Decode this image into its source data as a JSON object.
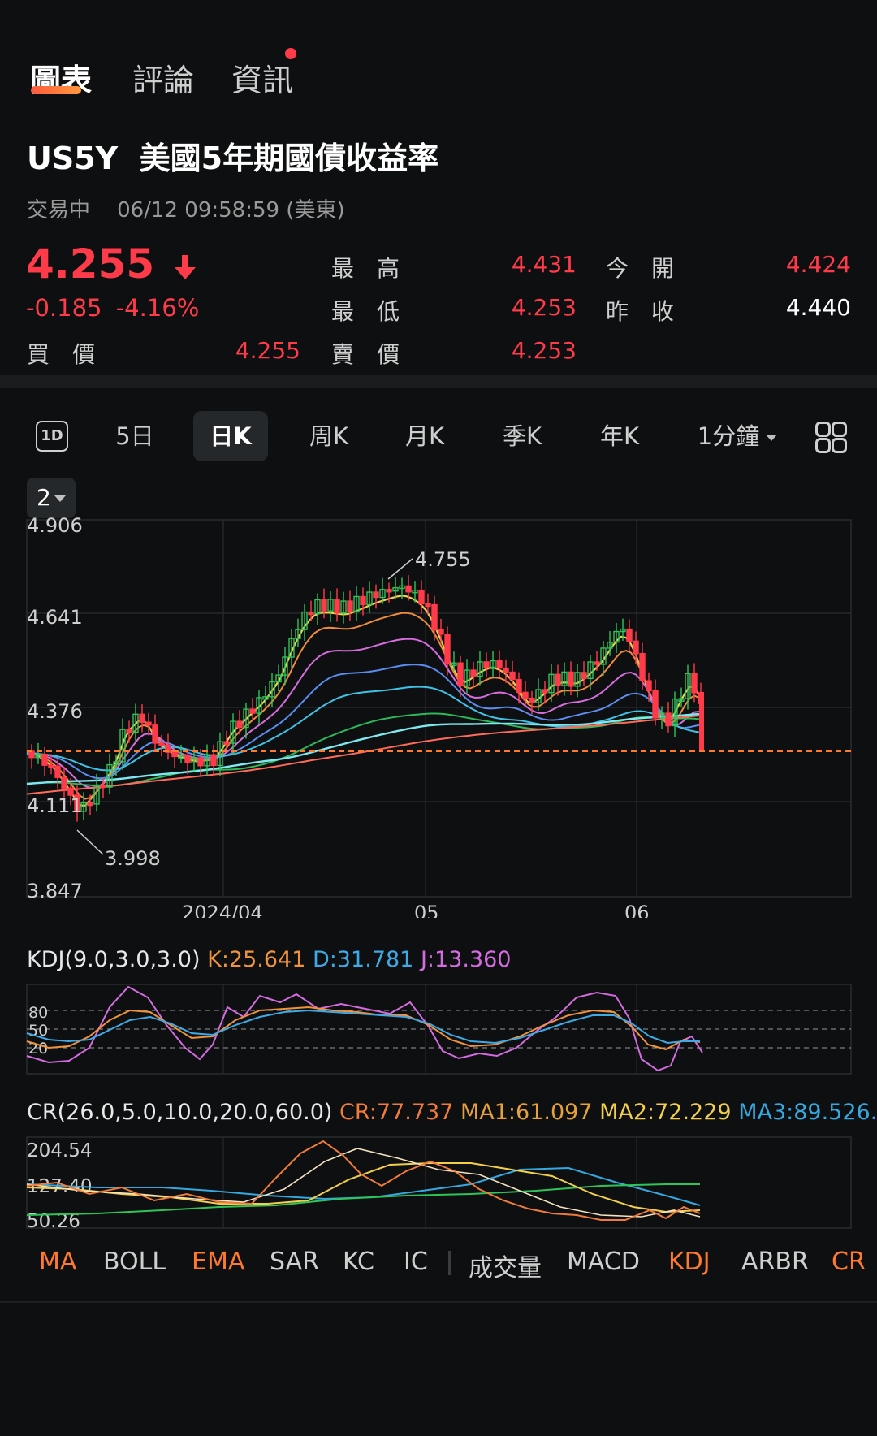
{
  "top_tabs": [
    {
      "label": "圖表",
      "active": true
    },
    {
      "label": "評論",
      "active": false
    },
    {
      "label": "資訊",
      "active": false,
      "notify_dot": true
    }
  ],
  "instrument": {
    "symbol": "US5Y",
    "name": "美國5年期國債收益率",
    "status": "交易中",
    "timestamp": "06/12 09:58:59 (美東)"
  },
  "quote": {
    "price": "4.255",
    "direction_icon": "arrow-down-icon",
    "change": "-0.185",
    "change_pct": "-4.16%",
    "bid_label": "買　價",
    "bid": "4.255",
    "ask_label": "賣　價",
    "ask": "4.253",
    "high_label": "最　高",
    "high": "4.431",
    "low_label": "最　低",
    "low": "4.253",
    "open_label": "今　開",
    "open": "4.424",
    "prev_close_label": "昨　收",
    "prev_close": "4.440"
  },
  "periods": [
    {
      "label": "1D",
      "icon": true
    },
    {
      "label": "5日"
    },
    {
      "label": "日K",
      "active": true
    },
    {
      "label": "周K"
    },
    {
      "label": "月K"
    },
    {
      "label": "季K"
    },
    {
      "label": "年K"
    },
    {
      "label": "1分鐘",
      "dropdown": true
    }
  ],
  "layout_selector": "2",
  "main_chart": {
    "y_ticks": [
      "4.906",
      "4.641",
      "4.376",
      "4.111",
      "3.847"
    ],
    "x_ticks": [
      "2024/04",
      "05",
      "06"
    ],
    "max_label": "4.755",
    "min_label": "3.998"
  },
  "kdj": {
    "title": "KDJ(9.0,3.0,3.0)",
    "k": "K:25.641",
    "d": "D:31.781",
    "j": "J:13.360",
    "levels": [
      "80",
      "50",
      "20"
    ]
  },
  "cr": {
    "title": "CR(26.0,5.0,10.0,20.0,60.0)",
    "cr": "CR:77.737",
    "ma1": "MA1:61.097",
    "ma2": "MA2:72.229",
    "ma3": "MA3:89.526...",
    "y_ticks": [
      "204.54",
      "127.40",
      "50.26"
    ]
  },
  "indicator_tabs": [
    {
      "label": "MA",
      "active": true
    },
    {
      "label": "BOLL"
    },
    {
      "label": "EMA",
      "active": true
    },
    {
      "label": "SAR"
    },
    {
      "label": "KC"
    },
    {
      "label": "IC"
    },
    {
      "label": "成交量"
    },
    {
      "label": "MACD"
    },
    {
      "label": "KDJ",
      "active": true
    },
    {
      "label": "ARBR"
    },
    {
      "label": "CR",
      "active": true
    }
  ],
  "colors": {
    "down": "#ff3b4a",
    "up": "#2fc45a",
    "accent": "#ff7a2e",
    "k": "#f0933b",
    "d": "#3fa9e6",
    "j": "#d46be0",
    "cr": "#f07b3b",
    "ma1": "#e6a13a",
    "ma2": "#f2cf4b",
    "ma3": "#35a8e0"
  }
}
